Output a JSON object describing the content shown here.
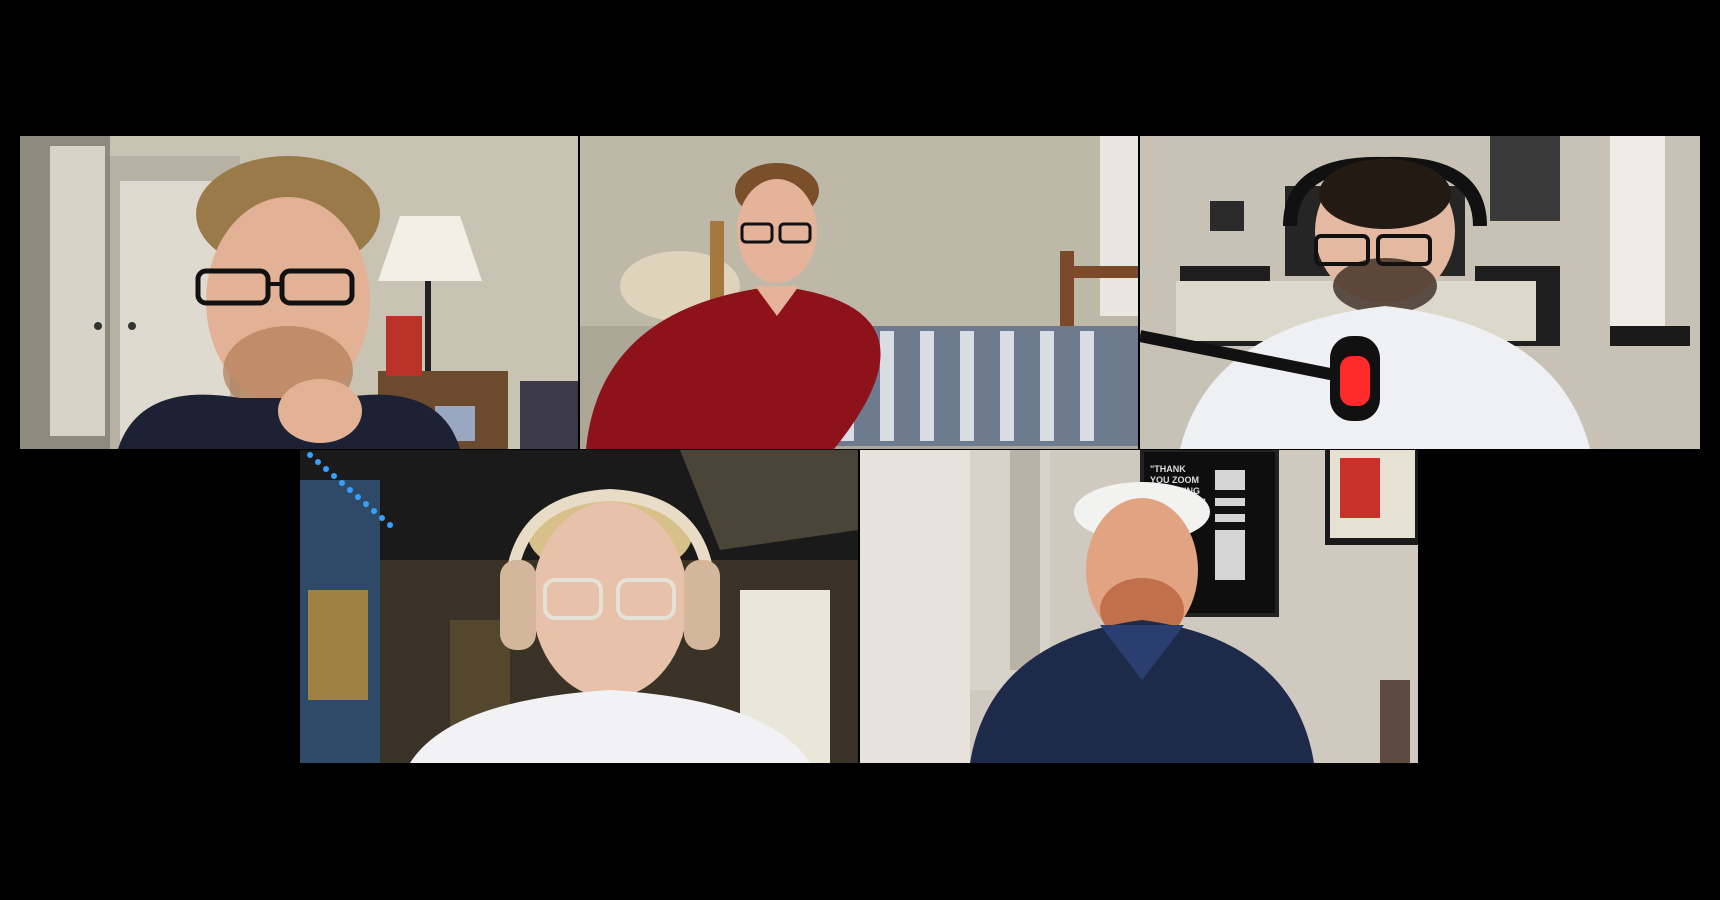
{
  "meeting": {
    "view": "gallery",
    "participant_count": 5
  },
  "participants": [
    {
      "position": "top-left",
      "video": "on"
    },
    {
      "position": "top-center",
      "video": "on"
    },
    {
      "position": "top-right",
      "video": "on"
    },
    {
      "position": "bottom-left",
      "video": "on"
    },
    {
      "position": "bottom-right",
      "video": "on"
    }
  ],
  "poster": {
    "text": "\"THANK YOU ZOOM FOR BEING A PARTNER\""
  },
  "colors": {
    "background": "#000000",
    "shirt_red": "#8e1219",
    "hoodie_navy": "#1e2a4a",
    "led_blue": "#3aa0ff",
    "mic_red": "#ff2a2a"
  }
}
